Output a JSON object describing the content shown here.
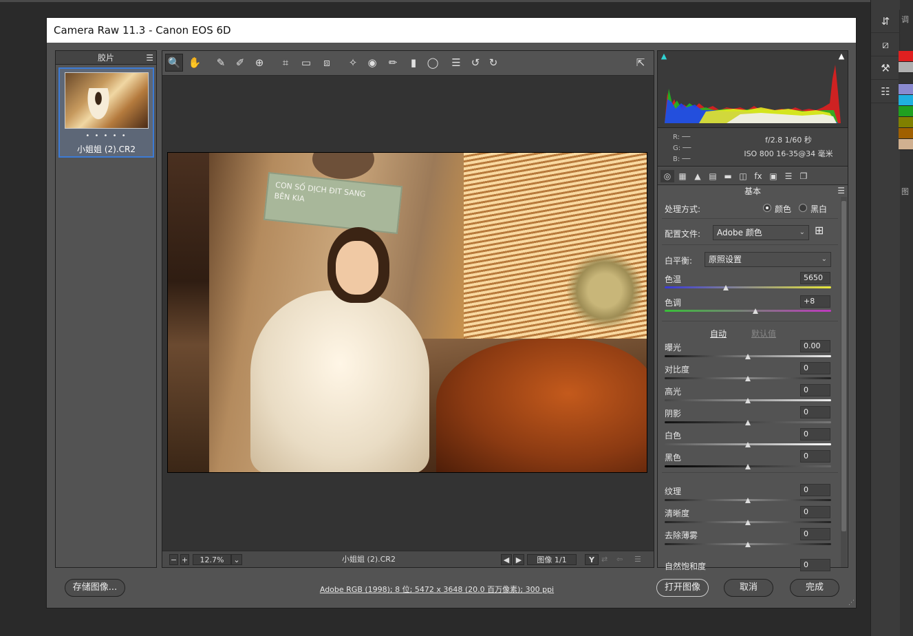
{
  "window": {
    "title": "Camera Raw 11.3 -  Canon EOS 6D"
  },
  "filmstrip": {
    "header": "胶片",
    "thumb_dots": "• • • • •",
    "filename": "小姐姐 (2).CR2"
  },
  "toolbar": {
    "tools": [
      {
        "name": "zoom-tool",
        "icon": "🔍"
      },
      {
        "name": "hand-tool",
        "icon": "✋"
      },
      {
        "name": "white-balance-tool",
        "icon": "✎"
      },
      {
        "name": "color-sampler-tool",
        "icon": "✐"
      },
      {
        "name": "targeted-adjustment-tool",
        "icon": "⊕"
      },
      {
        "name": "crop-tool",
        "icon": "⌗"
      },
      {
        "name": "straighten-tool",
        "icon": "▭"
      },
      {
        "name": "transform-tool",
        "icon": "⧈"
      },
      {
        "name": "spot-removal-tool",
        "icon": "✧"
      },
      {
        "name": "red-eye-tool",
        "icon": "◉"
      },
      {
        "name": "adjustment-brush-tool",
        "icon": "✏"
      },
      {
        "name": "graduated-filter-tool",
        "icon": "▮"
      },
      {
        "name": "radial-filter-tool",
        "icon": "◯"
      },
      {
        "name": "preferences-tool",
        "icon": "☰"
      },
      {
        "name": "rotate-left-tool",
        "icon": "↺"
      },
      {
        "name": "rotate-right-tool",
        "icon": "↻"
      }
    ],
    "fullscreen_icon": "⇱"
  },
  "preview": {
    "sign_text": "CON SỐ DỊCH ĐIT SANG\nBÊN KIA",
    "zoom": "12.7%",
    "filename": "小姐姐 (2).CR2",
    "image_counter": "图像 1/1",
    "before_after": "Y"
  },
  "histogram": {
    "exif_r": "R:  ──",
    "exif_g": "G:  ──",
    "exif_b": "B:  ──",
    "aperture_shutter": "f/2.8   1/60 秒",
    "iso_lens": "ISO 800   16-35@34 毫米"
  },
  "panel": {
    "title": "基本",
    "process_label": "处理方式:",
    "process_color": "颜色",
    "process_bw": "黑白",
    "profile_label": "配置文件:",
    "profile_value": "Adobe 颜色",
    "wb_label": "白平衡:",
    "wb_value": "原照设置",
    "temp_label": "色温",
    "temp_value": "5650",
    "tint_label": "色调",
    "tint_value": "+8",
    "auto": "自动",
    "default": "默认值",
    "exposure_label": "曝光",
    "exposure_value": "0.00",
    "contrast_label": "对比度",
    "contrast_value": "0",
    "highlights_label": "高光",
    "highlights_value": "0",
    "shadows_label": "阴影",
    "shadows_value": "0",
    "whites_label": "白色",
    "whites_value": "0",
    "blacks_label": "黑色",
    "blacks_value": "0",
    "texture_label": "纹理",
    "texture_value": "0",
    "clarity_label": "清晰度",
    "clarity_value": "0",
    "dehaze_label": "去除薄雾",
    "dehaze_value": "0",
    "vibrance_label": "自然饱和度",
    "vibrance_value": "0"
  },
  "footer": {
    "save": "存储图像...",
    "workflow_link": "Adobe RGB (1998); 8 位; 5472 x 3648 (20.0 百万像素); 300 ppi",
    "open": "打开图像",
    "cancel": "取消",
    "done": "完成"
  },
  "photoshop_right": {
    "panel_header": "调",
    "layers_header": "图",
    "swatch_colors": [
      "#e02020",
      "#b0b0b0",
      "#333333",
      "#8a8ad0",
      "#20b0e0",
      "#20a020",
      "#808000",
      "#a06000",
      "#d0b090"
    ]
  },
  "colors": {
    "accent_blue": "#3c7bd6",
    "dialog_bg": "#535353"
  }
}
